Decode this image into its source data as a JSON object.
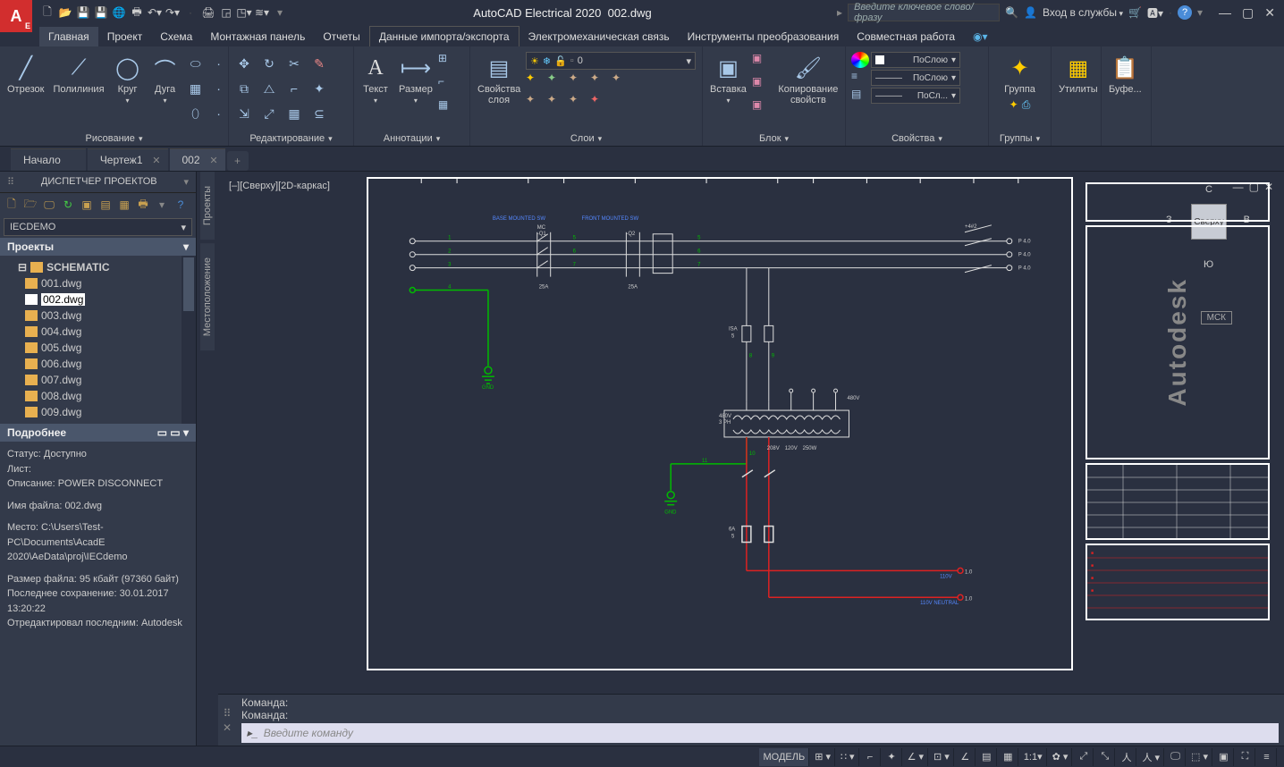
{
  "title": {
    "app": "AutoCAD Electrical 2020",
    "doc": "002.dwg"
  },
  "search_placeholder": "Введите ключевое слово/фразу",
  "login": "Вход в службы",
  "menu": [
    "Главная",
    "Проект",
    "Схема",
    "Монтажная панель",
    "Отчеты",
    "Данные импорта/экспорта",
    "Электромеханическая связь",
    "Инструменты преобразования",
    "Совместная работа"
  ],
  "ribbon": {
    "draw": {
      "label": "Рисование",
      "items": [
        "Отрезок",
        "Полилиния",
        "Круг",
        "Дуга"
      ]
    },
    "edit": {
      "label": "Редактирование"
    },
    "annot": {
      "label": "Аннотации",
      "items": [
        "Текст",
        "Размер"
      ]
    },
    "layers": {
      "label": "Слои",
      "props": "Свойства слоя",
      "current": "0"
    },
    "block": {
      "label": "Блок",
      "insert": "Вставка",
      "copy": "Копирование свойств"
    },
    "props": {
      "label": "Свойства",
      "bylayer": "ПоСлою",
      "bylayer2": "ПоСлою",
      "bylayer3": "ПоСл..."
    },
    "groups": {
      "label": "Группы",
      "btn": "Группа"
    },
    "utils": {
      "label": "Утилиты"
    },
    "clip": {
      "label": "Буфе..."
    }
  },
  "doctabs": [
    "Начало",
    "Чертеж1",
    "002"
  ],
  "sidetabs": [
    "Проекты",
    "Местоположение"
  ],
  "pm": {
    "title": "ДИСПЕТЧЕР ПРОЕКТОВ",
    "combo": "IECDEMO",
    "section": "Проекты",
    "folder": "SCHEMATIC",
    "files": [
      "001.dwg",
      "002.dwg",
      "003.dwg",
      "004.dwg",
      "005.dwg",
      "006.dwg",
      "007.dwg",
      "008.dwg",
      "009.dwg"
    ],
    "selected": "002.dwg",
    "details_title": "Подробнее",
    "details": {
      "status": "Статус: Доступно",
      "sheet": "Лист:",
      "desc": "Описание: POWER DISCONNECT",
      "fname": "Имя файла: 002.dwg",
      "loc": "Место: C:\\Users\\Test-PC\\Documents\\AcadE 2020\\AeData\\proj\\IECdemo",
      "size": "Размер файла: 95 кбайт (97360 байт)",
      "saved": "Последнее сохранение: 30.01.2017 13:20:22",
      "editor": "Отредактировал последним: Autodesk"
    }
  },
  "viewport_label": "[–][Сверху][2D-каркас]",
  "navcube": {
    "top": "Сверху",
    "n": "С",
    "s": "Ю",
    "e": "В",
    "w": "З",
    "msk": "МСК"
  },
  "cmd": {
    "line": "Команда:",
    "placeholder": "Введите команду"
  },
  "status": {
    "model": "МОДЕЛЬ",
    "scale": "1:1"
  },
  "schematic": {
    "labels": {
      "sw1": "BASE MOUNTED SW",
      "sw2": "FRONT MOUNTED SW",
      "mc": "MC",
      "q1": "-Q1",
      "q2": "-Q2",
      "a25_1": "25A",
      "a25_2": "25A",
      "vsource": "+4#2",
      "p4": "P 4.0",
      "gnd": "GND",
      "isa": "ISA",
      "s5": "5",
      "t480": "480V",
      "t3ph": "3 PH",
      "t208": "208V",
      "t120": "120V",
      "t250": "250W",
      "fu": "6A",
      "s5b": "5",
      "out1": "1.0",
      "out2": "1.0",
      "neutral": "110V NEUTRAL",
      "v110": "110V"
    }
  }
}
